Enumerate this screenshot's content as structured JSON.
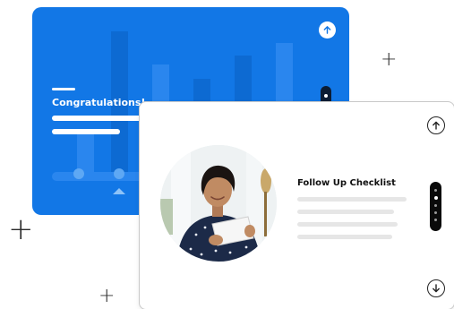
{
  "back_card": {
    "title": "Congratulations!",
    "color": "#1277e6"
  },
  "front_card": {
    "title": "Follow Up Checklist",
    "dots_pill": {
      "count": 5,
      "active_index": 1
    }
  },
  "icons": {
    "up": "arrow-up-icon",
    "down": "arrow-down-icon",
    "plus": "plus-icon"
  }
}
